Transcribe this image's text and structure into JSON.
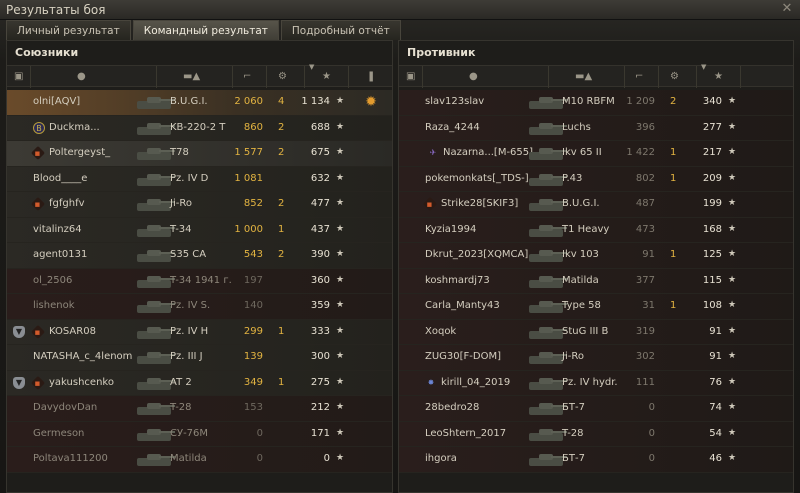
{
  "window": {
    "title": "Результаты боя",
    "close_icon": "close-icon"
  },
  "tabs": [
    {
      "label": "Личный результат",
      "active": false
    },
    {
      "label": "Командный результат",
      "active": true
    },
    {
      "label": "Подробный отчёт",
      "active": false
    }
  ],
  "allies": {
    "title": "Союзники",
    "rows": [
      {
        "badge": "",
        "name": "olni[AQV]",
        "vehicle": "B.U.G.I.",
        "damage": "2 060",
        "kills": "4",
        "xp": "1 134",
        "medal": true,
        "style": "self"
      },
      {
        "badge": "coin",
        "name": "Duckma...",
        "vehicle": "KB-220-2 T",
        "damage": "860",
        "kills": "2",
        "xp": "688",
        "medal": false,
        "style": "ally",
        "badge2": "coin"
      },
      {
        "badge": "diamond",
        "name": "Poltergeyst_",
        "vehicle": "T78",
        "damage": "1 577",
        "kills": "2",
        "xp": "675",
        "medal": false,
        "style": "plat"
      },
      {
        "badge": "",
        "name": "Blood____e",
        "vehicle": "Pz. IV D",
        "damage": "1 081",
        "kills": "",
        "xp": "632",
        "medal": false,
        "style": "ally"
      },
      {
        "badge": "diamond",
        "name": "fgfghfv",
        "vehicle": "Ji-Ro",
        "damage": "852",
        "kills": "2",
        "xp": "477",
        "medal": false,
        "style": "ally"
      },
      {
        "badge": "",
        "name": "vitalinz64",
        "vehicle": "T-34",
        "damage": "1 000",
        "kills": "1",
        "xp": "437",
        "medal": false,
        "style": "ally"
      },
      {
        "badge": "",
        "name": "agent0131",
        "vehicle": "S35 CA",
        "damage": "543",
        "kills": "2",
        "xp": "390",
        "medal": false,
        "style": "ally"
      },
      {
        "badge": "",
        "name": "ol_2506",
        "vehicle": "T-34 1941 г.",
        "damage": "197",
        "kills": "",
        "xp": "360",
        "medal": false,
        "style": "dead"
      },
      {
        "badge": "",
        "name": "lishenok",
        "vehicle": "Pz. IV S.",
        "damage": "140",
        "kills": "",
        "xp": "359",
        "medal": false,
        "style": "dead"
      },
      {
        "badge": "shield+diamond",
        "name": "KOSAR08",
        "vehicle": "Pz. IV H",
        "damage": "299",
        "kills": "1",
        "xp": "333",
        "medal": false,
        "style": "ally"
      },
      {
        "badge": "",
        "name": "NATASHA_c_4lenom",
        "vehicle": "Pz. III J",
        "damage": "139",
        "kills": "",
        "xp": "300",
        "medal": false,
        "style": "ally"
      },
      {
        "badge": "shield+diamond",
        "name": "yakushcenko",
        "vehicle": "AT 2",
        "damage": "349",
        "kills": "1",
        "xp": "275",
        "medal": false,
        "style": "ally"
      },
      {
        "badge": "",
        "name": "DavydovDan",
        "vehicle": "T-28",
        "damage": "153",
        "kills": "",
        "xp": "212",
        "medal": false,
        "style": "dead"
      },
      {
        "badge": "",
        "name": "Germeson",
        "vehicle": "СУ-76М",
        "damage": "0",
        "kills": "",
        "xp": "171",
        "medal": false,
        "style": "dead"
      },
      {
        "badge": "",
        "name": "Poltava111200",
        "vehicle": "Matilda",
        "damage": "0",
        "kills": "",
        "xp": "0",
        "medal": false,
        "style": "dead"
      }
    ]
  },
  "enemies": {
    "title": "Противник",
    "rows": [
      {
        "badge": "",
        "name": "slav123slav",
        "vehicle": "M10 RBFM",
        "damage": "1 209",
        "kills": "2",
        "xp": "340"
      },
      {
        "badge": "",
        "name": "Raza_4244",
        "vehicle": "Luchs",
        "damage": "396",
        "kills": "",
        "xp": "277"
      },
      {
        "badge": "plane",
        "name": "Nazarna...[M-655]",
        "vehicle": "Ikv 65 II",
        "damage": "1 422",
        "kills": "1",
        "xp": "217"
      },
      {
        "badge": "",
        "name": "pokemonkats[_TDS-]",
        "vehicle": "P.43",
        "damage": "802",
        "kills": "1",
        "xp": "209"
      },
      {
        "badge": "diamond",
        "name": "Strike28[SKIF3]",
        "vehicle": "B.U.G.I.",
        "damage": "487",
        "kills": "",
        "xp": "199"
      },
      {
        "badge": "",
        "name": "Kyzia1994",
        "vehicle": "T1 Heavy",
        "damage": "473",
        "kills": "",
        "xp": "168"
      },
      {
        "badge": "",
        "name": "Dkrut_2023[XQMCA]",
        "vehicle": "Ikv 103",
        "damage": "91",
        "kills": "1",
        "xp": "125"
      },
      {
        "badge": "",
        "name": "koshmardj73",
        "vehicle": "Matilda",
        "damage": "377",
        "kills": "",
        "xp": "115"
      },
      {
        "badge": "",
        "name": "Carla_Manty43",
        "vehicle": "Type 58",
        "damage": "31",
        "kills": "1",
        "xp": "108"
      },
      {
        "badge": "",
        "name": "Xoqok",
        "vehicle": "StuG III B",
        "damage": "319",
        "kills": "",
        "xp": "91"
      },
      {
        "badge": "",
        "name": "ZUG30[F-DOM]",
        "vehicle": "Ji-Ro",
        "damage": "302",
        "kills": "",
        "xp": "91"
      },
      {
        "badge": "star",
        "name": "kirill_04_2019",
        "vehicle": "Pz. IV hydr.",
        "damage": "111",
        "kills": "",
        "xp": "76"
      },
      {
        "badge": "",
        "name": "28bedro28",
        "vehicle": "БТ-7",
        "damage": "0",
        "kills": "",
        "xp": "74"
      },
      {
        "badge": "",
        "name": "LeoShtern_2017",
        "vehicle": "T-28",
        "damage": "0",
        "kills": "",
        "xp": "54"
      },
      {
        "badge": "",
        "name": "ihgora",
        "vehicle": "БТ-7",
        "damage": "0",
        "kills": "",
        "xp": "46"
      }
    ]
  },
  "colors": {
    "accent": "#e2b341",
    "self_row": "#6a4b2a",
    "enemy_row": "#2a1e1c"
  }
}
